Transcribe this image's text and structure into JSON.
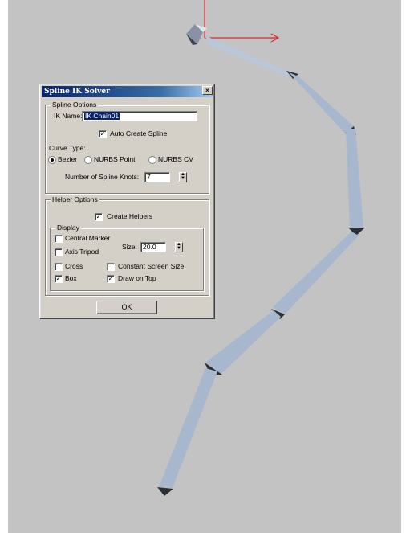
{
  "dialog": {
    "title": "Spline IK Solver",
    "close_glyph": "×",
    "spline_options": {
      "legend": "Spline Options",
      "ik_name_label": "IK Name:",
      "ik_name_value": "IK Chain01",
      "auto_create_spline_label": "Auto Create Spline",
      "auto_create_spline_checked": true,
      "curve_type_label": "Curve Type:",
      "curve_types": [
        "Bezier",
        "NURBS Point",
        "NURBS CV"
      ],
      "curve_type_selected": "Bezier",
      "knots_label": "Number of Spline Knots:",
      "knots_value": "7"
    },
    "helper_options": {
      "legend": "Helper Options",
      "create_helpers_label": "Create Helpers",
      "create_helpers_checked": true,
      "display": {
        "legend": "Display",
        "central_marker_label": "Central Marker",
        "central_marker_checked": false,
        "axis_tripod_label": "Axis Tripod",
        "axis_tripod_checked": false,
        "cross_label": "Cross",
        "cross_checked": false,
        "box_label": "Box",
        "box_checked": true,
        "size_label": "Size:",
        "size_value": "20.0",
        "constant_screen_size_label": "Constant Screen Size",
        "constant_screen_size_checked": false,
        "draw_on_top_label": "Draw on Top",
        "draw_on_top_checked": true
      }
    },
    "ok_label": "OK"
  },
  "colors": {
    "viewport_bg": "#c3c3c3",
    "bone_light": "#a7b8ce",
    "bone_dark": "#6e7f96",
    "bone_tip": "#2b2f36",
    "gizmo_x": "#e0252b",
    "titlebar": "#0a246a"
  },
  "icons": {
    "close": "close-icon",
    "spin": "spinner-icon",
    "gizmo": "transform-gizmo-icon"
  }
}
